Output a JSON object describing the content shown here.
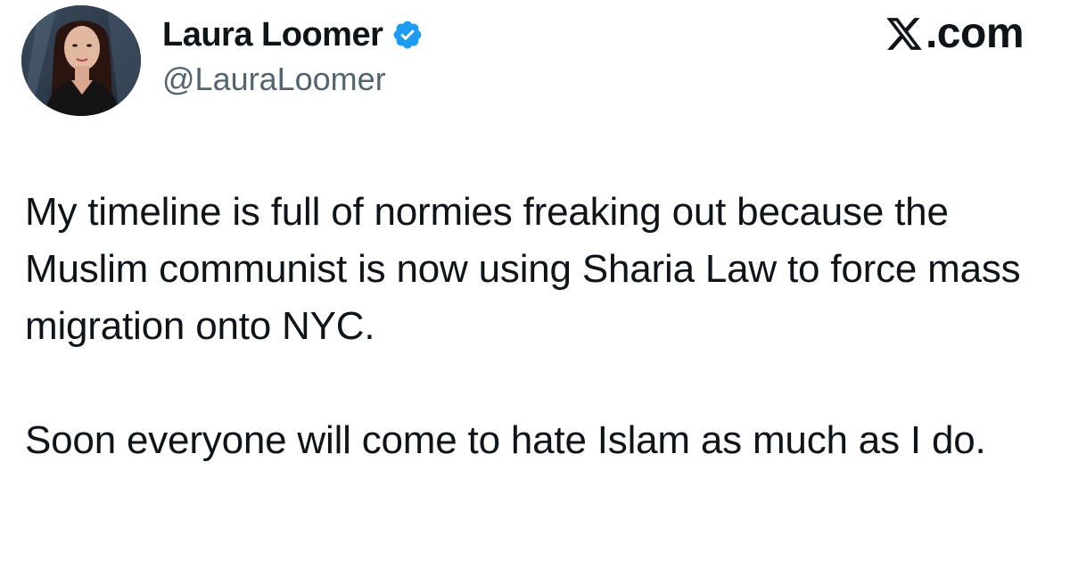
{
  "author": {
    "display_name": "Laura Loomer",
    "handle": "@LauraLoomer",
    "verified": true,
    "verified_color": "#1d9bf0",
    "avatar": "profile-photo"
  },
  "brand": {
    "label": ".com",
    "icon": "x-logo-icon"
  },
  "tweet": {
    "paragraphs": [
      "My timeline is full of normies freaking out because the Muslim communist is now using Sharia Law to force mass migration onto NYC.",
      "Soon everyone will come to hate Islam as much as I do."
    ]
  },
  "colors": {
    "text": "#0f1419",
    "secondary_text": "#536471",
    "background": "#ffffff"
  }
}
